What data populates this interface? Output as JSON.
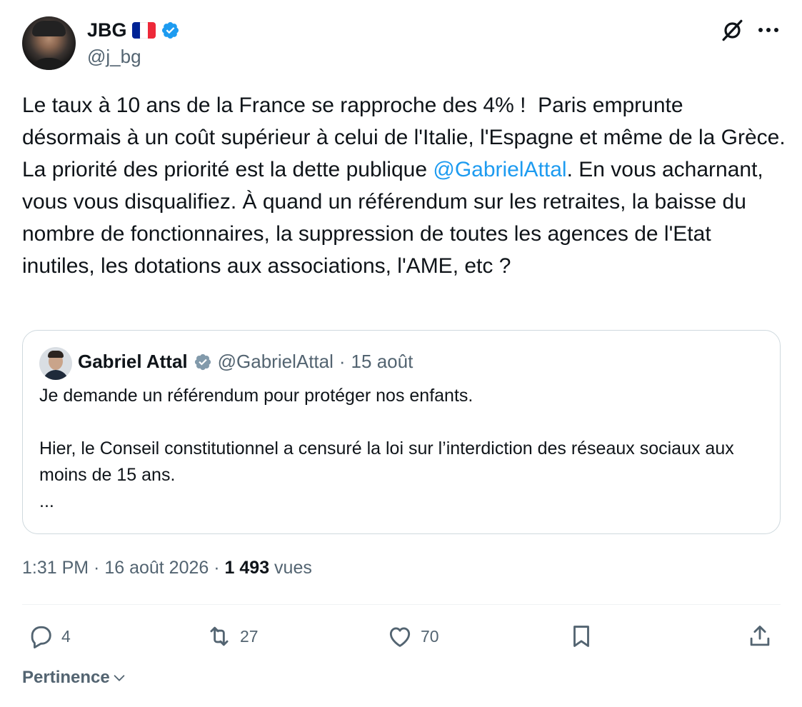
{
  "author": {
    "name": "JBG",
    "handle": "@j_bg",
    "flag_colors": [
      "#002395",
      "#ffffff",
      "#ed2939"
    ],
    "verified_color": "#1d9bf0"
  },
  "tweet": {
    "text_before_mention": "Le taux à 10 ans de la France se rapproche des 4% !  Paris emprunte désormais à un coût supérieur à celui de l'Italie, l'Espagne et même de la Grèce. La priorité des priorité est la dette publique ",
    "mention": "@GabrielAttal",
    "text_after_mention": ". En vous acharnant, vous vous disqualifiez. À quand un référendum sur les retraites, la baisse du nombre de fonctionnaires, la suppression de toutes les agences de l'Etat inutiles, les dotations aux associations, l'AME, etc ?",
    "mention_color": "#1d9bf0"
  },
  "quote": {
    "name": "Gabriel Attal",
    "handle": "@GabrielAttal",
    "separator": "·",
    "date": "15 août",
    "badge_color": "#829aab",
    "text": "Je demande un référendum pour protéger nos enfants.\n\nHier, le Conseil constitutionnel a censuré la loi sur l’interdiction des réseaux sociaux aux moins de 15 ans.\n..."
  },
  "meta": {
    "time": "1:31 PM",
    "sep1": " · ",
    "date": "16 août 2026",
    "sep2": " · ",
    "views_count": "1 493",
    "views_label": " vues"
  },
  "actions": {
    "replies": "4",
    "reposts": "27",
    "likes": "70"
  },
  "sort": {
    "label": "Pertinence"
  },
  "colors": {
    "text_primary": "#0f1419",
    "text_secondary": "#536471",
    "border": "#cfd9de"
  }
}
